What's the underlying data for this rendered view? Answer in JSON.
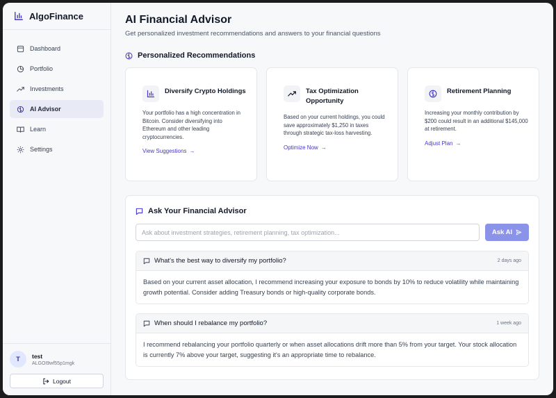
{
  "app": {
    "name": "AlgoFinance"
  },
  "sidebar": {
    "items": [
      {
        "label": "Dashboard",
        "icon": "home-icon"
      },
      {
        "label": "Portfolio",
        "icon": "pie-chart-icon"
      },
      {
        "label": "Investments",
        "icon": "trending-up-icon"
      },
      {
        "label": "AI Advisor",
        "icon": "brain-icon",
        "active": true
      },
      {
        "label": "Learn",
        "icon": "book-icon"
      },
      {
        "label": "Settings",
        "icon": "gear-icon"
      }
    ],
    "user": {
      "initial": "T",
      "name": "test",
      "id": "ALGOI9wf55p1mgk"
    },
    "logout_label": "Logout"
  },
  "main": {
    "title": "AI Financial Advisor",
    "subtitle": "Get personalized investment recommendations and answers to your financial questions",
    "recommendations": {
      "heading": "Personalized Recommendations",
      "cards": [
        {
          "title": "Diversify Crypto Holdings",
          "body": "Your portfolio has a high concentration in Bitcoin. Consider diversifying into Ethereum and other leading cryptocurrencies.",
          "link": "View Suggestions",
          "icon": "bar-chart-icon"
        },
        {
          "title": "Tax Optimization Opportunity",
          "body": "Based on your current holdings, you could save approximately $1,250 in taxes through strategic tax-loss harvesting.",
          "link": "Optimize Now",
          "icon": "trending-up-icon"
        },
        {
          "title": "Retirement Planning",
          "body": "Increasing your monthly contribution by $200 could result in an additional $145,000 at retirement.",
          "link": "Adjust Plan",
          "icon": "brain-icon"
        }
      ]
    },
    "advisor": {
      "heading": "Ask Your Financial Advisor",
      "placeholder": "Ask about investment strategies, retirement planning, tax optimization...",
      "button_label": "Ask AI",
      "conversations": [
        {
          "question": "What's the best way to diversify my portfolio?",
          "time": "2 days ago",
          "answer": "Based on your current asset allocation, I recommend increasing your exposure to bonds by 10% to reduce volatility while maintaining growth potential. Consider adding Treasury bonds or high-quality corporate bonds."
        },
        {
          "question": "When should I rebalance my portfolio?",
          "time": "1 week ago",
          "answer": "I recommend rebalancing your portfolio quarterly or when asset allocations drift more than 5% from your target. Your stock allocation is currently 7% above your target, suggesting it's an appropriate time to rebalance."
        }
      ]
    }
  },
  "colors": {
    "accent": "#4338ca",
    "button": "#8b93e8",
    "active_nav": "#e8eaf6"
  }
}
